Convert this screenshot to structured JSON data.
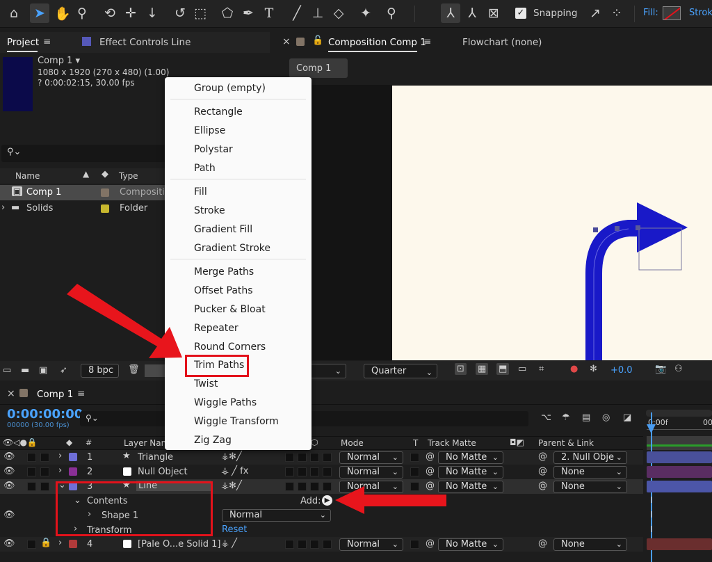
{
  "toolbar": {
    "snapping_label": "Snapping",
    "fill_label": "Fill:",
    "stroke_label": "Strok"
  },
  "project": {
    "tab_project": "Project",
    "tab_effect_controls": "Effect Controls Line",
    "comp_name": "Comp 1",
    "comp_size": "1080 x 1920  (270 x 480) (1.00)",
    "comp_duration": "? 0:00:02:15, 30.00 fps",
    "search_placeholder": "",
    "col_name": "Name",
    "col_type": "Type",
    "items": [
      {
        "name": "Comp 1",
        "type": "Compositio"
      },
      {
        "name": "Solids",
        "type": "Folder"
      }
    ],
    "bpc": "8 bpc"
  },
  "composition": {
    "tab_comp": "Composition Comp 1",
    "tab_flowchart": "Flowchart (none)",
    "subtab": "Comp 1",
    "resolution": "Quarter",
    "exposure": "+0.0"
  },
  "menu": {
    "items": [
      "Group (empty)",
      "Rectangle",
      "Ellipse",
      "Polystar",
      "Path",
      "Fill",
      "Stroke",
      "Gradient Fill",
      "Gradient Stroke",
      "Merge Paths",
      "Offset Paths",
      "Pucker & Bloat",
      "Repeater",
      "Round Corners",
      "Trim Paths",
      "Twist",
      "Wiggle Paths",
      "Wiggle Transform",
      "Zig Zag"
    ],
    "highlighted": "Trim Paths"
  },
  "timeline": {
    "tab": "Comp 1",
    "timecode": "0:00:00:00",
    "frames": "00000 (30.00 fps)",
    "ruler_start": "0:00f",
    "ruler_next": "00",
    "headers": {
      "num": "#",
      "layer_name": "Layer Name",
      "mode": "Mode",
      "t": "T",
      "track_matte": "Track Matte",
      "parent": "Parent & Link"
    },
    "layers": [
      {
        "num": "1",
        "name": "Triangle",
        "mode": "Normal",
        "matte": "No Matte",
        "parent": "2. Null Obje",
        "color": "#6f6fd8",
        "bar": "#49509a"
      },
      {
        "num": "2",
        "name": "Null Object",
        "mode": "Normal",
        "matte": "No Matte",
        "parent": "None",
        "color": "#8a2f95",
        "bar": "#5a2d62"
      },
      {
        "num": "3",
        "name": "Line",
        "mode": "Normal",
        "matte": "No Matte",
        "parent": "None",
        "color": "#6f6fd8",
        "bar": "#4c56a8"
      },
      {
        "num": "4",
        "name": "[Pale O...e Solid 1]",
        "mode": "Normal",
        "matte": "No Matte",
        "parent": "None",
        "color": "#b03a3a",
        "bar": "#6a2e2e"
      }
    ],
    "contents_label": "Contents",
    "add_label": "Add:",
    "shape_label": "Shape 1",
    "shape_mode": "Normal",
    "transform_label": "Transform",
    "reset_label": "Reset"
  },
  "colors": {
    "accent": "#2d8ceb",
    "highlight_red": "#e3121b",
    "shape_blue": "#1919c8",
    "canvas": "#fdf8ec"
  }
}
